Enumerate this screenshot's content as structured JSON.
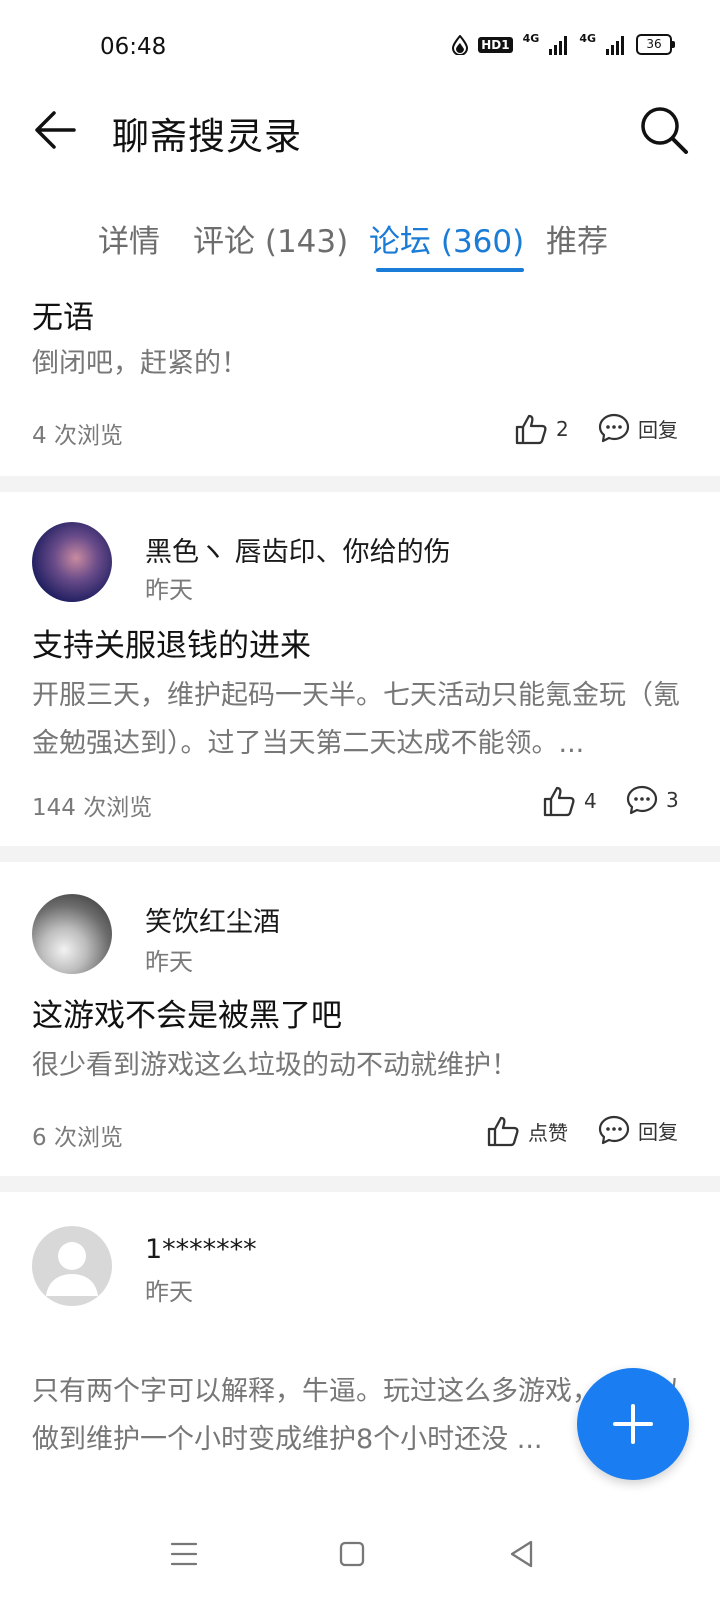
{
  "status_bar": {
    "time": "06:48",
    "hd_label": "HD1",
    "net1": "4G",
    "net2": "4G",
    "battery": "36"
  },
  "app_bar": {
    "title": "聊斋搜灵录"
  },
  "tabs": [
    {
      "label": "详情"
    },
    {
      "label": "评论 (143)"
    },
    {
      "label": "论坛 (360)"
    },
    {
      "label": "推荐"
    }
  ],
  "active_tab": "论坛 (360)",
  "posts": [
    {
      "title": "无语",
      "body": "倒闭吧，赶紧的！",
      "views": "4 次浏览",
      "likes": "2",
      "reply": "回复"
    },
    {
      "author": "黑色ヽ 唇齿印、你给的伤",
      "time": "昨天",
      "title": "支持关服退钱的进来",
      "body": "开服三天，维护起码一天半。七天活动只能氪金玩（氪金勉强达到）。过了当天第二天达成不能领。...",
      "views": "144 次浏览",
      "likes": "4",
      "comments": "3"
    },
    {
      "author": "笑饮红尘酒",
      "time": "昨天",
      "title": "这游戏不会是被黑了吧",
      "body": "很少看到游戏这么垃圾的动不动就维护！",
      "views": "6 次浏览",
      "likes": "点赞",
      "reply": "回复"
    },
    {
      "author": "1*******",
      "time": "昨天",
      "body": "只有两个字可以解释，牛逼。玩过这么多游戏，个可以做到维护一个小时变成维护8个小时还没 ..."
    }
  ],
  "colors": {
    "accent": "#1a7cd6",
    "fab": "#1a7ef2",
    "separator": "#f3f3f3"
  },
  "icons": [
    "back-arrow-icon",
    "search-icon",
    "thumbs-up-icon",
    "comment-bubble-icon",
    "plus-icon",
    "menu-icon",
    "home-square-icon",
    "back-triangle-icon"
  ]
}
